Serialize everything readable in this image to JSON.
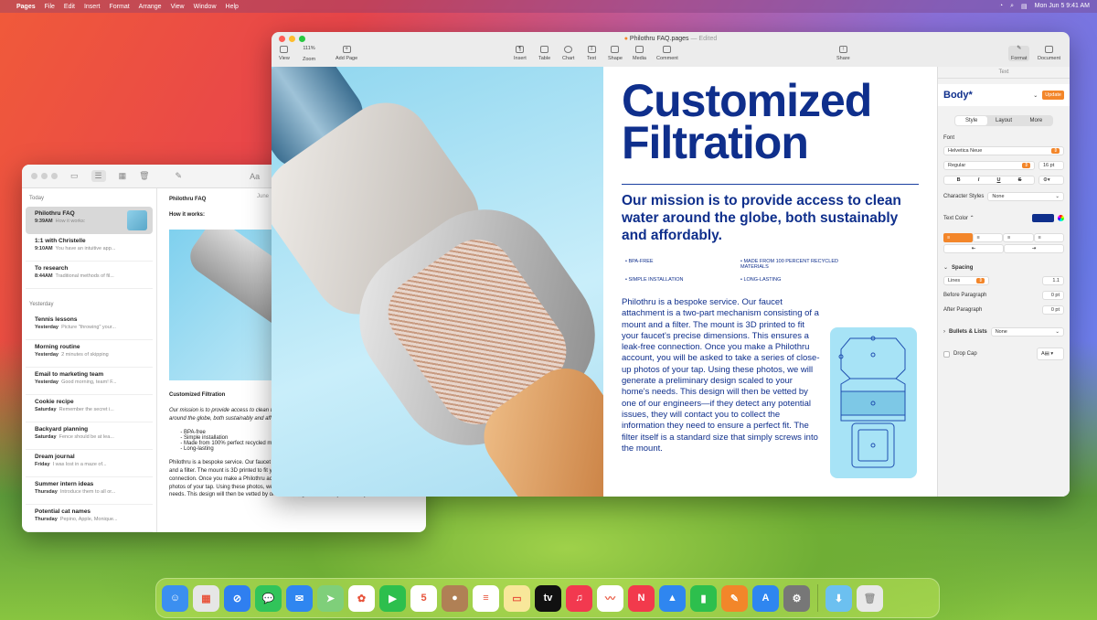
{
  "menubar": {
    "app": "Pages",
    "items": [
      "File",
      "Edit",
      "Insert",
      "Format",
      "Arrange",
      "View",
      "Window",
      "Help"
    ],
    "clock": "Mon Jun 5  9:41 AM"
  },
  "notes": {
    "format_icon": "Aa",
    "sections": [
      {
        "title": "Today",
        "items": [
          {
            "title": "Philothru FAQ",
            "time": "9:39AM",
            "preview": "How it works:"
          },
          {
            "title": "1:1 with Christelle",
            "time": "9:10AM",
            "preview": "You have an intuitive app..."
          },
          {
            "title": "To research",
            "time": "8:44AM",
            "preview": "Traditional methods of fil..."
          }
        ]
      },
      {
        "title": "Yesterday",
        "items": [
          {
            "title": "Tennis lessons",
            "time": "Yesterday",
            "preview": "Picture \"throwing\" your..."
          },
          {
            "title": "Morning routine",
            "time": "Yesterday",
            "preview": "2 minutes of skipping"
          },
          {
            "title": "Email to marketing team",
            "time": "Yesterday",
            "preview": "Good morning, team! F..."
          },
          {
            "title": "Cookie recipe",
            "time": "Saturday",
            "preview": "Remember the secret i..."
          },
          {
            "title": "Backyard planning",
            "time": "Saturday",
            "preview": "Fence should be at lea..."
          },
          {
            "title": "Dream journal",
            "time": "Friday",
            "preview": "I was lost in a maze of..."
          },
          {
            "title": "Summer intern ideas",
            "time": "Thursday",
            "preview": "Introduce them to all or..."
          },
          {
            "title": "Potential cat names",
            "time": "Thursday",
            "preview": "Pepino, Apple, Monique..."
          }
        ]
      }
    ],
    "content": {
      "date": "June",
      "title": "Philothru FAQ",
      "subtitle": "How it works:",
      "heading": "Customized Filtration",
      "mission": "Our mission is to provide access to clean water around the globe, both sustainably and affordably",
      "bullets": [
        "BPA-free",
        "Simple installation",
        "Made from 100% perfect recycled materials",
        "Long-lasting"
      ],
      "body": "Philothru is a bespoke service. Our faucet attachment is a two-part mechanism consisting of a mount and a filter. The mount is 3D printed to fit your faucet's precise dimensions. This ensures a leak-free connection. Once you make a Philothru account, you will be asked to take a series of close-up photos of your tap. Using these photos, we will generate a preliminary design scaled to your home's needs. This design will then be vetted by one of our engineers—if they detect any"
    }
  },
  "pages": {
    "filename": "Philothru FAQ.pages",
    "status": "— Edited",
    "toolbar": {
      "view": "View",
      "zoom_value": "111%",
      "zoom": "Zoom",
      "add_page": "Add Page",
      "insert": "Insert",
      "table": "Table",
      "chart": "Chart",
      "text": "Text",
      "shape": "Shape",
      "media": "Media",
      "comment": "Comment",
      "share": "Share",
      "format": "Format",
      "document": "Document"
    },
    "doc": {
      "title1": "Customized",
      "title2": "Filtration",
      "mission": "Our mission is to provide access to clean water around the globe, both sustainably and affordably.",
      "bullets": [
        "BPA-FREE",
        "MADE FROM 100 PERCENT RECYCLED MATERIALS",
        "SIMPLE INSTALLATION",
        "LONG-LASTING"
      ],
      "body": "Philothru is a bespoke service. Our faucet attachment is a two-part mechanism consisting of a mount and a filter. The mount is 3D printed to fit your faucet's precise dimensions. This ensures a leak-free connection. Once you make a Philothru account, you will be asked to take a series of close-up photos of your tap. Using these photos, we will generate a preliminary design scaled to your home's needs. This design will then be vetted by one of our engineers—if they detect any potential issues, they will contact you to collect the information they need to ensure a perfect fit. The filter itself is a standard size that simply screws into the mount."
    },
    "inspector": {
      "header": "Text",
      "style": "Body*",
      "update": "Update",
      "tabs": [
        "Style",
        "Layout",
        "More"
      ],
      "font_label": "Font",
      "font": "Helvetica Neue",
      "weight": "Regular",
      "size": "16 pt",
      "bold": "B",
      "italic": "I",
      "underline": "U",
      "strike": "S",
      "char_styles_label": "Character Styles",
      "char_styles": "None",
      "text_color_label": "Text Color ⌃",
      "text_color": "#0f2f8c",
      "spacing_label": "Spacing",
      "lines": "Lines",
      "line_value": "1.1",
      "before_label": "Before Paragraph",
      "before": "0 pt",
      "after_label": "After Paragraph",
      "after": "0 pt",
      "bullets_label": "Bullets & Lists",
      "bullets": "None",
      "dropcap_label": "Drop Cap"
    }
  },
  "dock": {
    "apps": [
      {
        "name": "finder",
        "color": "#3b8ff0",
        "g": "☺"
      },
      {
        "name": "launchpad",
        "color": "#e6e6e6",
        "g": "▦"
      },
      {
        "name": "safari",
        "color": "#2f7ff0",
        "g": "⊘"
      },
      {
        "name": "messages",
        "color": "#31c45a",
        "g": "💬"
      },
      {
        "name": "mail",
        "color": "#2f86f0",
        "g": "✉"
      },
      {
        "name": "maps",
        "color": "#7fcf7a",
        "g": "➤"
      },
      {
        "name": "photos",
        "color": "#ffffff",
        "g": "✿"
      },
      {
        "name": "facetime",
        "color": "#2dbf4d",
        "g": "▶"
      },
      {
        "name": "calendar",
        "color": "#ffffff",
        "g": "5"
      },
      {
        "name": "contacts",
        "color": "#b08055",
        "g": "●"
      },
      {
        "name": "reminders",
        "color": "#ffffff",
        "g": "≡"
      },
      {
        "name": "notes",
        "color": "#f8e79a",
        "g": "▭"
      },
      {
        "name": "tv",
        "color": "#111111",
        "g": "tv"
      },
      {
        "name": "music",
        "color": "#f2394f",
        "g": "♫"
      },
      {
        "name": "freeform",
        "color": "#ffffff",
        "g": "〰"
      },
      {
        "name": "news",
        "color": "#f23a4c",
        "g": "N"
      },
      {
        "name": "keynote",
        "color": "#2f86f0",
        "g": "▲"
      },
      {
        "name": "numbers",
        "color": "#2dbf4d",
        "g": "▮"
      },
      {
        "name": "pages",
        "color": "#f2862a",
        "g": "✎"
      },
      {
        "name": "app-store",
        "color": "#2f86f0",
        "g": "A"
      },
      {
        "name": "system-settings",
        "color": "#777777",
        "g": "⚙"
      }
    ],
    "folder_color": "#6cc0f0",
    "trash_color": "#e8e8e8"
  }
}
